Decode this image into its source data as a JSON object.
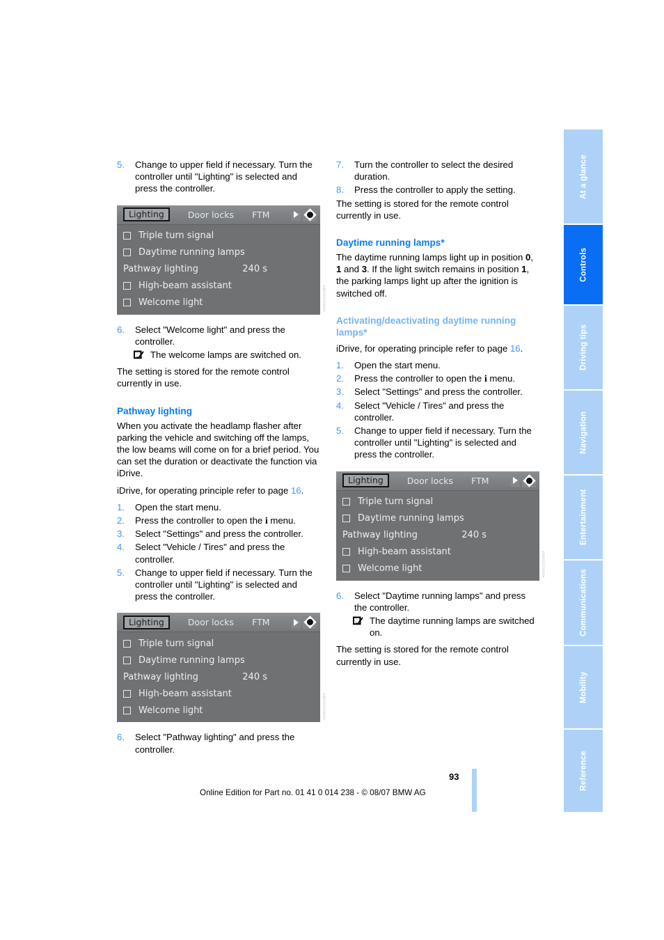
{
  "document": {
    "page_number": "93",
    "footer_text": "Online Edition for Part no. 01 41 0 014 238 - © 08/07 BMW AG"
  },
  "register": {
    "tabs": [
      {
        "label": "At a glance",
        "active": false
      },
      {
        "label": "Controls",
        "active": true
      },
      {
        "label": "Driving tips",
        "active": false
      },
      {
        "label": "Navigation",
        "active": false
      },
      {
        "label": "Entertainment",
        "active": false
      },
      {
        "label": "Communications",
        "active": false
      },
      {
        "label": "Mobility",
        "active": false
      },
      {
        "label": "Reference",
        "active": false
      }
    ],
    "active_color": "#0a6ef5",
    "inactive_color": "#aed2f7"
  },
  "idrive_screen": {
    "tabs": [
      {
        "label": "Lighting",
        "selected": true
      },
      {
        "label": "Door locks",
        "selected": false
      },
      {
        "label": "FTM",
        "selected": false
      }
    ],
    "arrow_icon": "arrow-right-icon",
    "controller_icon": "controller-icon",
    "rows": [
      {
        "label": "Triple turn signal",
        "checkbox": true,
        "value": ""
      },
      {
        "label": "Daytime running lamps",
        "checkbox": true,
        "value": ""
      },
      {
        "label": "Pathway lighting",
        "checkbox": false,
        "value": "240 s"
      },
      {
        "label": "High-beam assistant",
        "checkbox": true,
        "value": ""
      },
      {
        "label": "Welcome light",
        "checkbox": true,
        "value": ""
      }
    ],
    "figure_code": "VIRGO0235903A"
  },
  "left_column": {
    "step5_num": "5.",
    "step5_text": "Change to upper field if necessary. Turn the controller until \"Lighting\" is selected and press the controller.",
    "step6_num": "6.",
    "step6_text": "Select \"Welcome light\" and press the controller.",
    "step6_notice": "The welcome lamps are switched on.",
    "stored_note": "The setting is stored for the remote control currently in use.",
    "heading_pathway": "Pathway lighting",
    "pathway_body": "When you activate the headlamp flasher after parking the vehicle and switching off the lamps, the low beams will come on for a brief period. You can set the duration or deactivate the function via iDrive.",
    "idrive_ref_pre": "iDrive, for operating principle refer to page ",
    "idrive_ref_page": "16",
    "idrive_ref_post": ".",
    "steps": [
      {
        "num": "1.",
        "text": "Open the start menu."
      },
      {
        "num": "2.",
        "text": "Press the controller to open the i menu.",
        "has_i_glyph": true,
        "before_i": "Press the controller to open the ",
        "after_i": " menu."
      },
      {
        "num": "3.",
        "text": "Select \"Settings\" and press the controller."
      },
      {
        "num": "4.",
        "text": "Select \"Vehicle / Tires\" and press the controller."
      },
      {
        "num": "5.",
        "text": "Change to upper field if necessary. Turn the controller until \"Lighting\" is selected and press the controller."
      }
    ],
    "final_step_num": "6.",
    "final_step_text": "Select \"Pathway lighting\" and press the controller."
  },
  "right_column": {
    "steps_top": [
      {
        "num": "7.",
        "text": "Turn the controller to select the desired duration."
      },
      {
        "num": "8.",
        "text": "Press the controller to apply the setting."
      }
    ],
    "stored_note": "The setting is stored for the remote control currently in use.",
    "heading_drl": "Daytime running lamps*",
    "drl_body_1": "The daytime running lamps light up in position ",
    "drl_pos_0": "0",
    "drl_body_2": ", ",
    "drl_pos_1": "1",
    "drl_body_3": " and ",
    "drl_pos_3": "3",
    "drl_body_4": ". If the light switch remains in position ",
    "drl_pos_1b": "1",
    "drl_body_5": ", the parking lamps light up after the ignition is switched off.",
    "subheading_activating": "Activating/deactivating daytime running lamps*",
    "idrive_ref_pre": "iDrive, for operating principle refer to page ",
    "idrive_ref_page": "16",
    "idrive_ref_post": ".",
    "steps": [
      {
        "num": "1.",
        "text": "Open the start menu."
      },
      {
        "num": "2.",
        "before_i": "Press the controller to open the ",
        "after_i": " menu.",
        "has_i_glyph": true
      },
      {
        "num": "3.",
        "text": "Select \"Settings\" and press the controller."
      },
      {
        "num": "4.",
        "text": "Select \"Vehicle / Tires\" and press the controller."
      },
      {
        "num": "5.",
        "text": "Change to upper field if necessary. Turn the controller until \"Lighting\" is selected and press the controller."
      }
    ],
    "final_step_num": "6.",
    "final_step_text": "Select \"Daytime running lamps\" and press the controller.",
    "final_notice": "The daytime running lamps are switched on.",
    "final_stored_note": "The setting is stored for the remote control currently in use."
  },
  "colors": {
    "heading_blue": "#0a7cf5",
    "subheading_blue": "#74b4f4",
    "step_number_blue": "#3d97f3",
    "idrive_background": "#6f7173"
  }
}
